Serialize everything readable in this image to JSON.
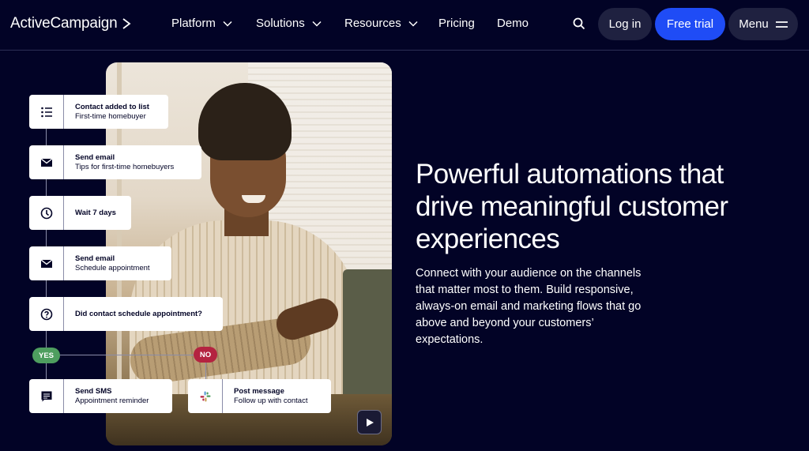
{
  "header": {
    "logo": "ActiveCampaign",
    "nav": [
      {
        "label": "Platform",
        "has_dropdown": true
      },
      {
        "label": "Solutions",
        "has_dropdown": true
      },
      {
        "label": "Resources",
        "has_dropdown": true
      },
      {
        "label": "Pricing",
        "has_dropdown": false
      },
      {
        "label": "Demo",
        "has_dropdown": false
      }
    ],
    "search_icon": "search-icon",
    "login_label": "Log in",
    "trial_label": "Free trial",
    "menu_label": "Menu"
  },
  "colors": {
    "background": "#020326",
    "primary_button": "#1f4cf6",
    "secondary_button": "#1f2140",
    "yes_badge": "#4e9e5f",
    "no_badge": "#b42340"
  },
  "workflow": {
    "steps": [
      {
        "icon": "list-icon",
        "title": "Contact added to list",
        "subtitle": "First-time homebuyer"
      },
      {
        "icon": "envelope-icon",
        "title": "Send email",
        "subtitle": "Tips for first-time homebuyers"
      },
      {
        "icon": "clock-icon",
        "title": "Wait 7 days",
        "subtitle": ""
      },
      {
        "icon": "envelope-icon",
        "title": "Send email",
        "subtitle": "Schedule appointment"
      },
      {
        "icon": "question-icon",
        "title": "Did contact schedule appointment?",
        "subtitle": ""
      }
    ],
    "yes_label": "YES",
    "no_label": "NO",
    "yes_branch": {
      "icon": "sms-icon",
      "title": "Send SMS",
      "subtitle": "Appointment reminder"
    },
    "no_branch": {
      "icon": "slack-icon",
      "title": "Post message",
      "subtitle": "Follow up with contact"
    }
  },
  "media": {
    "play_icon": "play-icon"
  },
  "hero": {
    "title": "Powerful automations that drive meaningful customer experiences",
    "body": "Connect with your audience on the channels that matter most to them. Build responsive, always-on email and marketing flows that go above and beyond your customers’ expectations."
  }
}
